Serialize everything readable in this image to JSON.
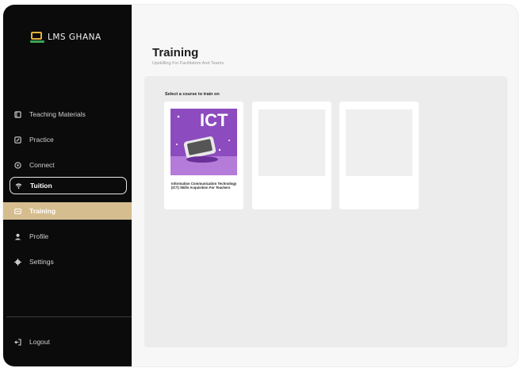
{
  "brand": {
    "name": "LMS GHANA"
  },
  "sidebar": {
    "items": [
      {
        "label": "Teaching Materials",
        "icon": "book-icon"
      },
      {
        "label": "Practice",
        "icon": "pencil-icon"
      },
      {
        "label": "Connect",
        "icon": "connect-icon"
      },
      {
        "label": "Tuition",
        "icon": "wifi-icon"
      },
      {
        "label": "Training",
        "icon": "training-icon"
      },
      {
        "label": "Profile",
        "icon": "user-icon"
      },
      {
        "label": "Settings",
        "icon": "gear-icon"
      }
    ],
    "logout": {
      "label": "Logout",
      "icon": "logout-icon"
    }
  },
  "main": {
    "title": "Training",
    "subtitle": "Upskilling For Facilitators And Teams",
    "select_label": "Select a course to train on",
    "courses": [
      {
        "badge": "ICT",
        "title": "Information Communication Technology (ICT) Skills Acquisition For Teachers"
      }
    ]
  },
  "colors": {
    "sidebar_bg": "#0b0b0b",
    "active_item": "#d6bd8f",
    "course_cover": "#8c4bbf"
  }
}
